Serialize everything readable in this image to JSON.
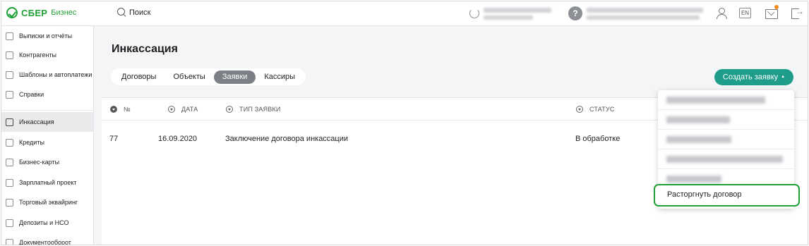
{
  "header": {
    "logo_text": "СБЕР",
    "logo_sub": "Бизнес",
    "search_label": "Поиск",
    "lang": "EN"
  },
  "sidebar": {
    "items": [
      {
        "label": "Выписки и отчёты"
      },
      {
        "label": "Контрагенты"
      },
      {
        "label": "Шаблоны и автоплатежи"
      },
      {
        "label": "Справки"
      },
      {
        "label": "Инкассация",
        "active": true
      },
      {
        "label": "Кредиты"
      },
      {
        "label": "Бизнес-карты"
      },
      {
        "label": "Зарплатный проект"
      },
      {
        "label": "Торговый эквайринг"
      },
      {
        "label": "Депозиты и НСО"
      },
      {
        "label": "Документооборот"
      }
    ]
  },
  "main": {
    "title": "Инкассация",
    "tabs": [
      {
        "label": "Договоры",
        "active": false
      },
      {
        "label": "Объекты",
        "active": false
      },
      {
        "label": "Заявки",
        "active": true
      },
      {
        "label": "Кассиры",
        "active": false
      }
    ],
    "create_button": "Создать заявку",
    "table": {
      "columns": [
        "№",
        "ДАТА",
        "ТИП ЗАЯВКИ",
        "СТАТУС"
      ],
      "rows": [
        {
          "number": "77",
          "date": "16.09.2020",
          "type": "Заключение договора инкассации",
          "status": "В обработке"
        }
      ]
    },
    "dropdown": {
      "highlighted_item": "Расторгнуть договор"
    }
  },
  "colors": {
    "brand_green": "#21a038",
    "accent_teal": "#1f9d8b",
    "active_tab": "#7c8086"
  }
}
